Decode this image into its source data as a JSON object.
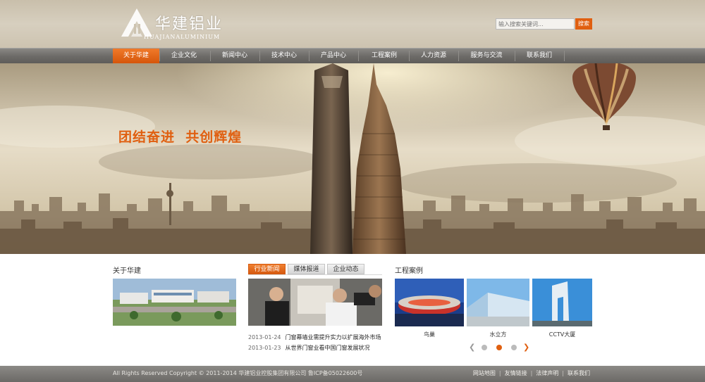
{
  "header": {
    "logo_cn": "华建铝业",
    "logo_en": "HUAJIANALUMINIUM",
    "search_placeholder": "输入搜索关键词...",
    "search_button": "搜索"
  },
  "nav": {
    "items": [
      {
        "label": "关于华建",
        "active": true
      },
      {
        "label": "企业文化"
      },
      {
        "label": "新闻中心"
      },
      {
        "label": "技术中心"
      },
      {
        "label": "产品中心"
      },
      {
        "label": "工程案例"
      },
      {
        "label": "人力资源"
      },
      {
        "label": "服务与交流"
      },
      {
        "label": "联系我们"
      }
    ]
  },
  "banner": {
    "slogan": "团结奋进  共创辉煌"
  },
  "about": {
    "title": "关于华建"
  },
  "news": {
    "tabs": [
      "行业新闻",
      "媒体报道",
      "企业动态"
    ],
    "items": [
      {
        "date": "2013-01-24",
        "title": "门窗幕墙业需提升实力以扩展海外市场"
      },
      {
        "date": "2013-01-23",
        "title": "从世界门窗业看中国门窗发展状况"
      }
    ]
  },
  "cases": {
    "title": "工程案例",
    "items": [
      {
        "label": "鸟巢"
      },
      {
        "label": "水立方"
      },
      {
        "label": "CCTV大厦"
      }
    ],
    "current_page": 2,
    "page_count": 4
  },
  "footer": {
    "copyright": "All Rights Reserved Copyright © 2011-2014  华建铝业控股集团有限公司  鲁ICP备05022600号",
    "links": [
      "网站地图",
      "友情链接",
      "法律声明",
      "联系我们"
    ]
  },
  "colors": {
    "accent": "#e05f10",
    "nav_bg": "#6e6c69"
  }
}
